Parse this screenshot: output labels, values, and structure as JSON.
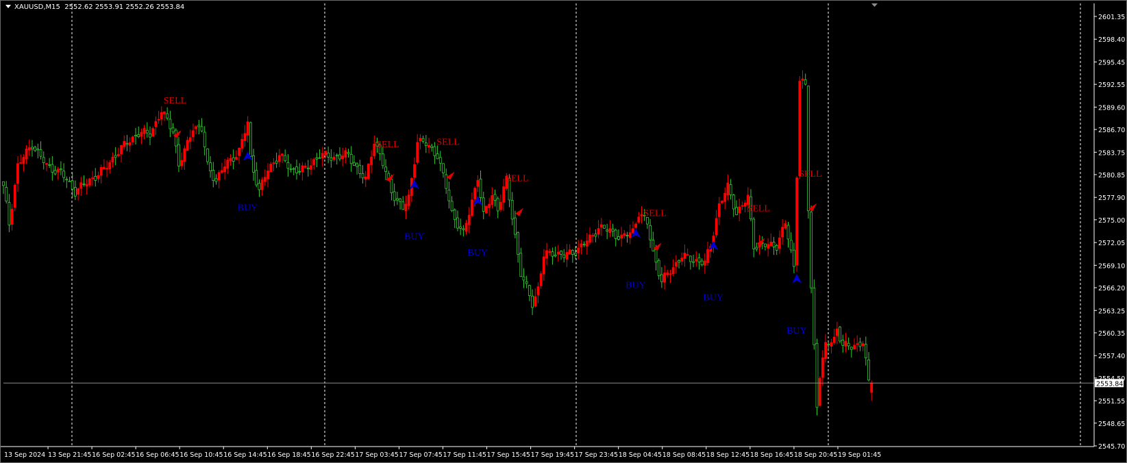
{
  "header": {
    "symbol": "XAUUSD,M15",
    "ohlc": "2552.62 2553.91 2552.26 2553.84"
  },
  "colors": {
    "background": "#000000",
    "bull_candle": "#ff0000",
    "bear_candle": "#32cd32",
    "sell": "#e00000",
    "buy": "#0000d0",
    "grid_separator": "#ffffff",
    "price_line": "#8c8c8c"
  },
  "chart_data": {
    "type": "candlestick",
    "title": "XAUUSD,M15",
    "ylim": [
      2545.7,
      2601.35
    ],
    "current_price": "2553.84",
    "yticks": [
      "2601.35",
      "2598.40",
      "2595.45",
      "2592.55",
      "2589.60",
      "2586.70",
      "2583.75",
      "2580.85",
      "2577.90",
      "2575.00",
      "2572.05",
      "2569.10",
      "2566.20",
      "2563.25",
      "2560.35",
      "2557.40",
      "2554.50",
      "2551.55",
      "2548.65",
      "2545.70"
    ],
    "xlabels": [
      "13 Sep 2024",
      "13 Sep 21:45",
      "16 Sep 02:45",
      "16 Sep 06:45",
      "16 Sep 10:45",
      "16 Sep 14:45",
      "16 Sep 18:45",
      "16 Sep 22:45",
      "17 Sep 03:45",
      "17 Sep 07:45",
      "17 Sep 11:45",
      "17 Sep 15:45",
      "17 Sep 19:45",
      "17 Sep 23:45",
      "18 Sep 04:45",
      "18 Sep 08:45",
      "18 Sep 12:45",
      "18 Sep 16:45",
      "18 Sep 20:45",
      "19 Sep 01:45"
    ],
    "bars_per_label": 16,
    "close_path": [
      [
        0,
        2579.2
      ],
      [
        2,
        2574.5
      ],
      [
        5,
        2582.0
      ],
      [
        10,
        2584.8
      ],
      [
        15,
        2582.0
      ],
      [
        20,
        2581.1
      ],
      [
        25,
        2578.7
      ],
      [
        30,
        2580.1
      ],
      [
        35,
        2581.5
      ],
      [
        40,
        2583.9
      ],
      [
        44,
        2585.3
      ],
      [
        47,
        2586.2
      ],
      [
        51,
        2586.2
      ],
      [
        55,
        2589.0
      ],
      [
        59,
        2586.7
      ],
      [
        61,
        2582.0
      ],
      [
        64,
        2584.8
      ],
      [
        66,
        2587.1
      ],
      [
        69,
        2586.7
      ],
      [
        71,
        2582.0
      ],
      [
        74,
        2580.1
      ],
      [
        77,
        2582.0
      ],
      [
        82,
        2583.9
      ],
      [
        85,
        2587.6
      ],
      [
        86,
        2582.9
      ],
      [
        89,
        2578.7
      ],
      [
        92,
        2581.5
      ],
      [
        96,
        2583.4
      ],
      [
        100,
        2581.5
      ],
      [
        105,
        2581.5
      ],
      [
        110,
        2583.4
      ],
      [
        115,
        2583.1
      ],
      [
        120,
        2583.4
      ],
      [
        124,
        2581.1
      ],
      [
        126,
        2580.1
      ],
      [
        129,
        2585.3
      ],
      [
        131,
        2583.4
      ],
      [
        135,
        2578.7
      ],
      [
        139,
        2576.4
      ],
      [
        141,
        2577.8
      ],
      [
        144,
        2585.3
      ],
      [
        147,
        2584.8
      ],
      [
        151,
        2583.4
      ],
      [
        154,
        2579.2
      ],
      [
        156,
        2575.9
      ],
      [
        160,
        2573.1
      ],
      [
        162,
        2575.9
      ],
      [
        165,
        2580.6
      ],
      [
        167,
        2575.5
      ],
      [
        170,
        2578.3
      ],
      [
        172,
        2576.4
      ],
      [
        175,
        2580.1
      ],
      [
        177,
        2575.5
      ],
      [
        180,
        2568.0
      ],
      [
        184,
        2564.2
      ],
      [
        186,
        2566.1
      ],
      [
        188,
        2570.3
      ],
      [
        191,
        2570.8
      ],
      [
        195,
        2570.3
      ],
      [
        200,
        2571.2
      ],
      [
        204,
        2572.6
      ],
      [
        207,
        2574.0
      ],
      [
        211,
        2573.6
      ],
      [
        215,
        2572.6
      ],
      [
        219,
        2573.6
      ],
      [
        221,
        2575.9
      ],
      [
        224,
        2574.5
      ],
      [
        226,
        2570.8
      ],
      [
        229,
        2567.0
      ],
      [
        232,
        2568.4
      ],
      [
        236,
        2570.3
      ],
      [
        240,
        2569.8
      ],
      [
        244,
        2569.4
      ],
      [
        246,
        2571.7
      ],
      [
        249,
        2576.9
      ],
      [
        252,
        2579.2
      ],
      [
        255,
        2575.9
      ],
      [
        259,
        2577.8
      ],
      [
        261,
        2571.7
      ],
      [
        265,
        2571.7
      ],
      [
        269,
        2571.7
      ],
      [
        272,
        2574.5
      ],
      [
        275,
        2568.9
      ],
      [
        277,
        2593.2
      ],
      [
        279,
        2592.3
      ],
      [
        280,
        2576.4
      ],
      [
        281,
        2566.1
      ],
      [
        283,
        2551.1
      ],
      [
        284,
        2554.9
      ],
      [
        286,
        2558.6
      ],
      [
        289,
        2559.6
      ],
      [
        290,
        2561.0
      ],
      [
        292,
        2558.6
      ],
      [
        295,
        2558.6
      ],
      [
        299,
        2559.1
      ],
      [
        301,
        2553.9
      ],
      [
        302,
        2553.84
      ]
    ],
    "signals": [
      {
        "type": "sell",
        "label": "SELL",
        "bar": 60,
        "price": 2586.1
      },
      {
        "type": "sell",
        "label": "SELL",
        "bar": 134,
        "price": 2580.4
      },
      {
        "type": "sell",
        "label": "SELL",
        "bar": 155,
        "price": 2580.7
      },
      {
        "type": "sell",
        "label": "SELL",
        "bar": 179,
        "price": 2576.0
      },
      {
        "type": "sell",
        "label": "SELL",
        "bar": 227,
        "price": 2571.5
      },
      {
        "type": "sell",
        "label": "SELL",
        "bar": 263,
        "price": 2572.1
      },
      {
        "type": "sell",
        "label": "SELL",
        "bar": 281,
        "price": 2576.6
      },
      {
        "type": "buy",
        "label": "BUY",
        "bar": 85,
        "price": 2583.1
      },
      {
        "type": "buy",
        "label": "BUY",
        "bar": 143,
        "price": 2579.4
      },
      {
        "type": "buy",
        "label": "BUY",
        "bar": 165,
        "price": 2577.3
      },
      {
        "type": "buy",
        "label": "BUY",
        "bar": 220,
        "price": 2573.1
      },
      {
        "type": "buy",
        "label": "BUY",
        "bar": 247,
        "price": 2571.5
      },
      {
        "type": "buy",
        "label": "BUY",
        "bar": 276,
        "price": 2567.2
      }
    ]
  }
}
